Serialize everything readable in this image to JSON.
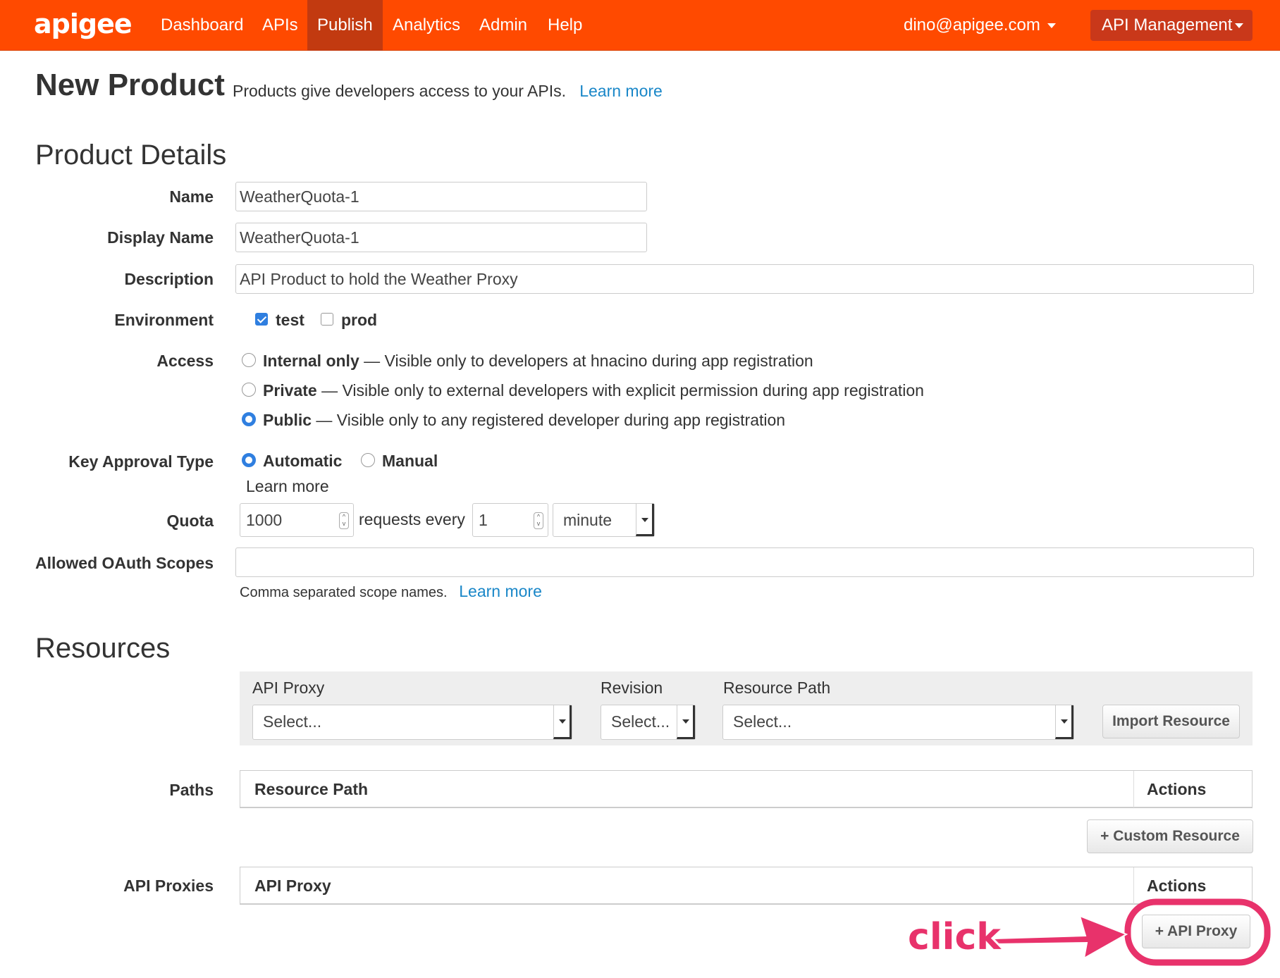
{
  "navbar": {
    "brand": "apigee",
    "items": [
      "Dashboard",
      "APIs",
      "Publish",
      "Analytics",
      "Admin",
      "Help"
    ],
    "active": "Publish",
    "user": "dino@apigee.com",
    "menu": "API Management",
    "colors": {
      "bar": "#ff4a00",
      "active": "#c23a10"
    }
  },
  "header": {
    "title": "New Product",
    "subtitle": "Products give developers access to your APIs.",
    "learn_more": "Learn more"
  },
  "details": {
    "section": "Product Details",
    "name_label": "Name",
    "name_value": "WeatherQuota-1",
    "display_name_label": "Display Name",
    "display_name_value": "WeatherQuota-1",
    "description_label": "Description",
    "description_value": "API Product to hold the Weather Proxy",
    "environment_label": "Environment",
    "env_test": "test",
    "env_prod": "prod",
    "access_label": "Access",
    "access_internal": "Internal only",
    "access_internal_desc": " — Visible only to developers at hnacino during app registration",
    "access_private": "Private",
    "access_private_desc": " — Visible only to external developers with explicit permission during app registration",
    "access_public": "Public",
    "access_public_desc": " — Visible only to any registered developer during app registration",
    "key_approval_label": "Key Approval Type",
    "key_automatic": "Automatic",
    "key_manual": "Manual",
    "key_learn_more": "Learn more",
    "quota_label": "Quota",
    "quota_value": "1000",
    "quota_requests_every": "requests every",
    "quota_interval": "1",
    "quota_unit": "minute",
    "scopes_label": "Allowed OAuth Scopes",
    "scopes_value": "",
    "scopes_help": "Comma separated scope names.",
    "scopes_learn_more": "Learn more"
  },
  "resources": {
    "section": "Resources",
    "proxy_head": "API Proxy",
    "revision_head": "Revision",
    "path_head": "Resource Path",
    "proxy_select": "Select...",
    "revision_select": "Select...",
    "path_select": "Select...",
    "import_button": "Import Resource",
    "paths_label": "Paths",
    "paths_col1": "Resource Path",
    "paths_col2": "Actions",
    "custom_resource_button": "+ Custom Resource",
    "proxies_label": "API Proxies",
    "proxies_col1": "API Proxy",
    "proxies_col2": "Actions",
    "add_proxy_button": "+ API Proxy"
  },
  "annotation": {
    "text": "click",
    "color": "#e8326b"
  }
}
